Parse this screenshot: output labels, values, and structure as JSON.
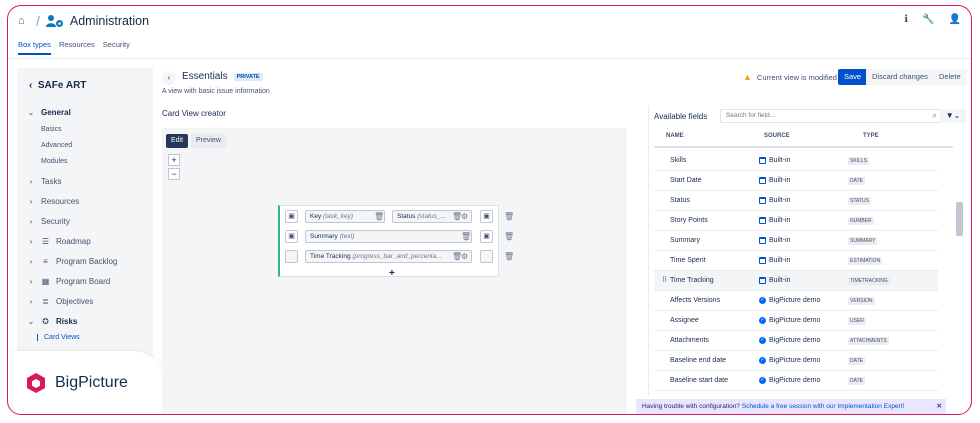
{
  "app": {
    "title": "Administration"
  },
  "tabs": [
    "Box types",
    "Resources",
    "Security"
  ],
  "sidebar": {
    "heading": "SAFe ART",
    "sections": [
      {
        "label": "General",
        "expanded": true,
        "bold": true
      },
      {
        "label": "Tasks"
      },
      {
        "label": "Resources"
      },
      {
        "label": "Security"
      },
      {
        "label": "Roadmap"
      },
      {
        "label": "Program Backlog"
      },
      {
        "label": "Program Board"
      },
      {
        "label": "Objectives"
      },
      {
        "label": "Risks",
        "expanded": true,
        "bold": true
      }
    ],
    "general_items": [
      "Basics",
      "Advanced",
      "Modules"
    ],
    "risks_items": [
      "Card Views"
    ]
  },
  "brand": {
    "name": "BigPicture",
    "color": "#d81b60"
  },
  "view": {
    "title": "Essentials",
    "badge": "PRIVATE",
    "description": "A view with basic issue information",
    "modified_text": "Current view is modified",
    "save_label": "Save",
    "discard_label": "Discard changes",
    "delete_label": "Delete"
  },
  "creator": {
    "label": "Card View creator",
    "edit_label": "Edit",
    "preview_label": "Preview",
    "zoom_in": "+",
    "zoom_out": "−",
    "add": "+",
    "fields": [
      {
        "name": "Key",
        "key": "(task_key)"
      },
      {
        "name": "Status",
        "key": "(status_..."
      },
      {
        "name": "Summary",
        "key": "(text)"
      },
      {
        "name": "Time Tracking",
        "key": "(progress_bar_and_percenta..."
      }
    ]
  },
  "available": {
    "label": "Available fields",
    "search_placeholder": "Search for field...",
    "columns": [
      "NAME",
      "SOURCE",
      "TYPE"
    ],
    "rows": [
      {
        "name": "Skills",
        "source": "Built-in",
        "type": "SKILLS"
      },
      {
        "name": "Start Date",
        "source": "Built-in",
        "type": "DATE"
      },
      {
        "name": "Status",
        "source": "Built-in",
        "type": "STATUS"
      },
      {
        "name": "Story Points",
        "source": "Built-in",
        "type": "NUMBER"
      },
      {
        "name": "Summary",
        "source": "Built-in",
        "type": "SUMMARY"
      },
      {
        "name": "Time Spent",
        "source": "Built-in",
        "type": "ESTIMATION"
      },
      {
        "name": "Time Tracking",
        "source": "Built-in",
        "type": "TIMETRACKING"
      },
      {
        "name": "Affects Versions",
        "source": "BigPicture demo",
        "type": "VERSION"
      },
      {
        "name": "Assignee",
        "source": "BigPicture demo",
        "type": "USER"
      },
      {
        "name": "Attachments",
        "source": "BigPicture demo",
        "type": "ATTACHMENTS"
      },
      {
        "name": "Baseline end date",
        "source": "BigPicture demo",
        "type": "DATE"
      },
      {
        "name": "Baseline start date",
        "source": "BigPicture demo",
        "type": "DATE"
      }
    ]
  },
  "banner": {
    "text": "Having trouble with configuration? ",
    "link": "Schedule a free session with our Implementation Expert!",
    "close": "✕"
  }
}
